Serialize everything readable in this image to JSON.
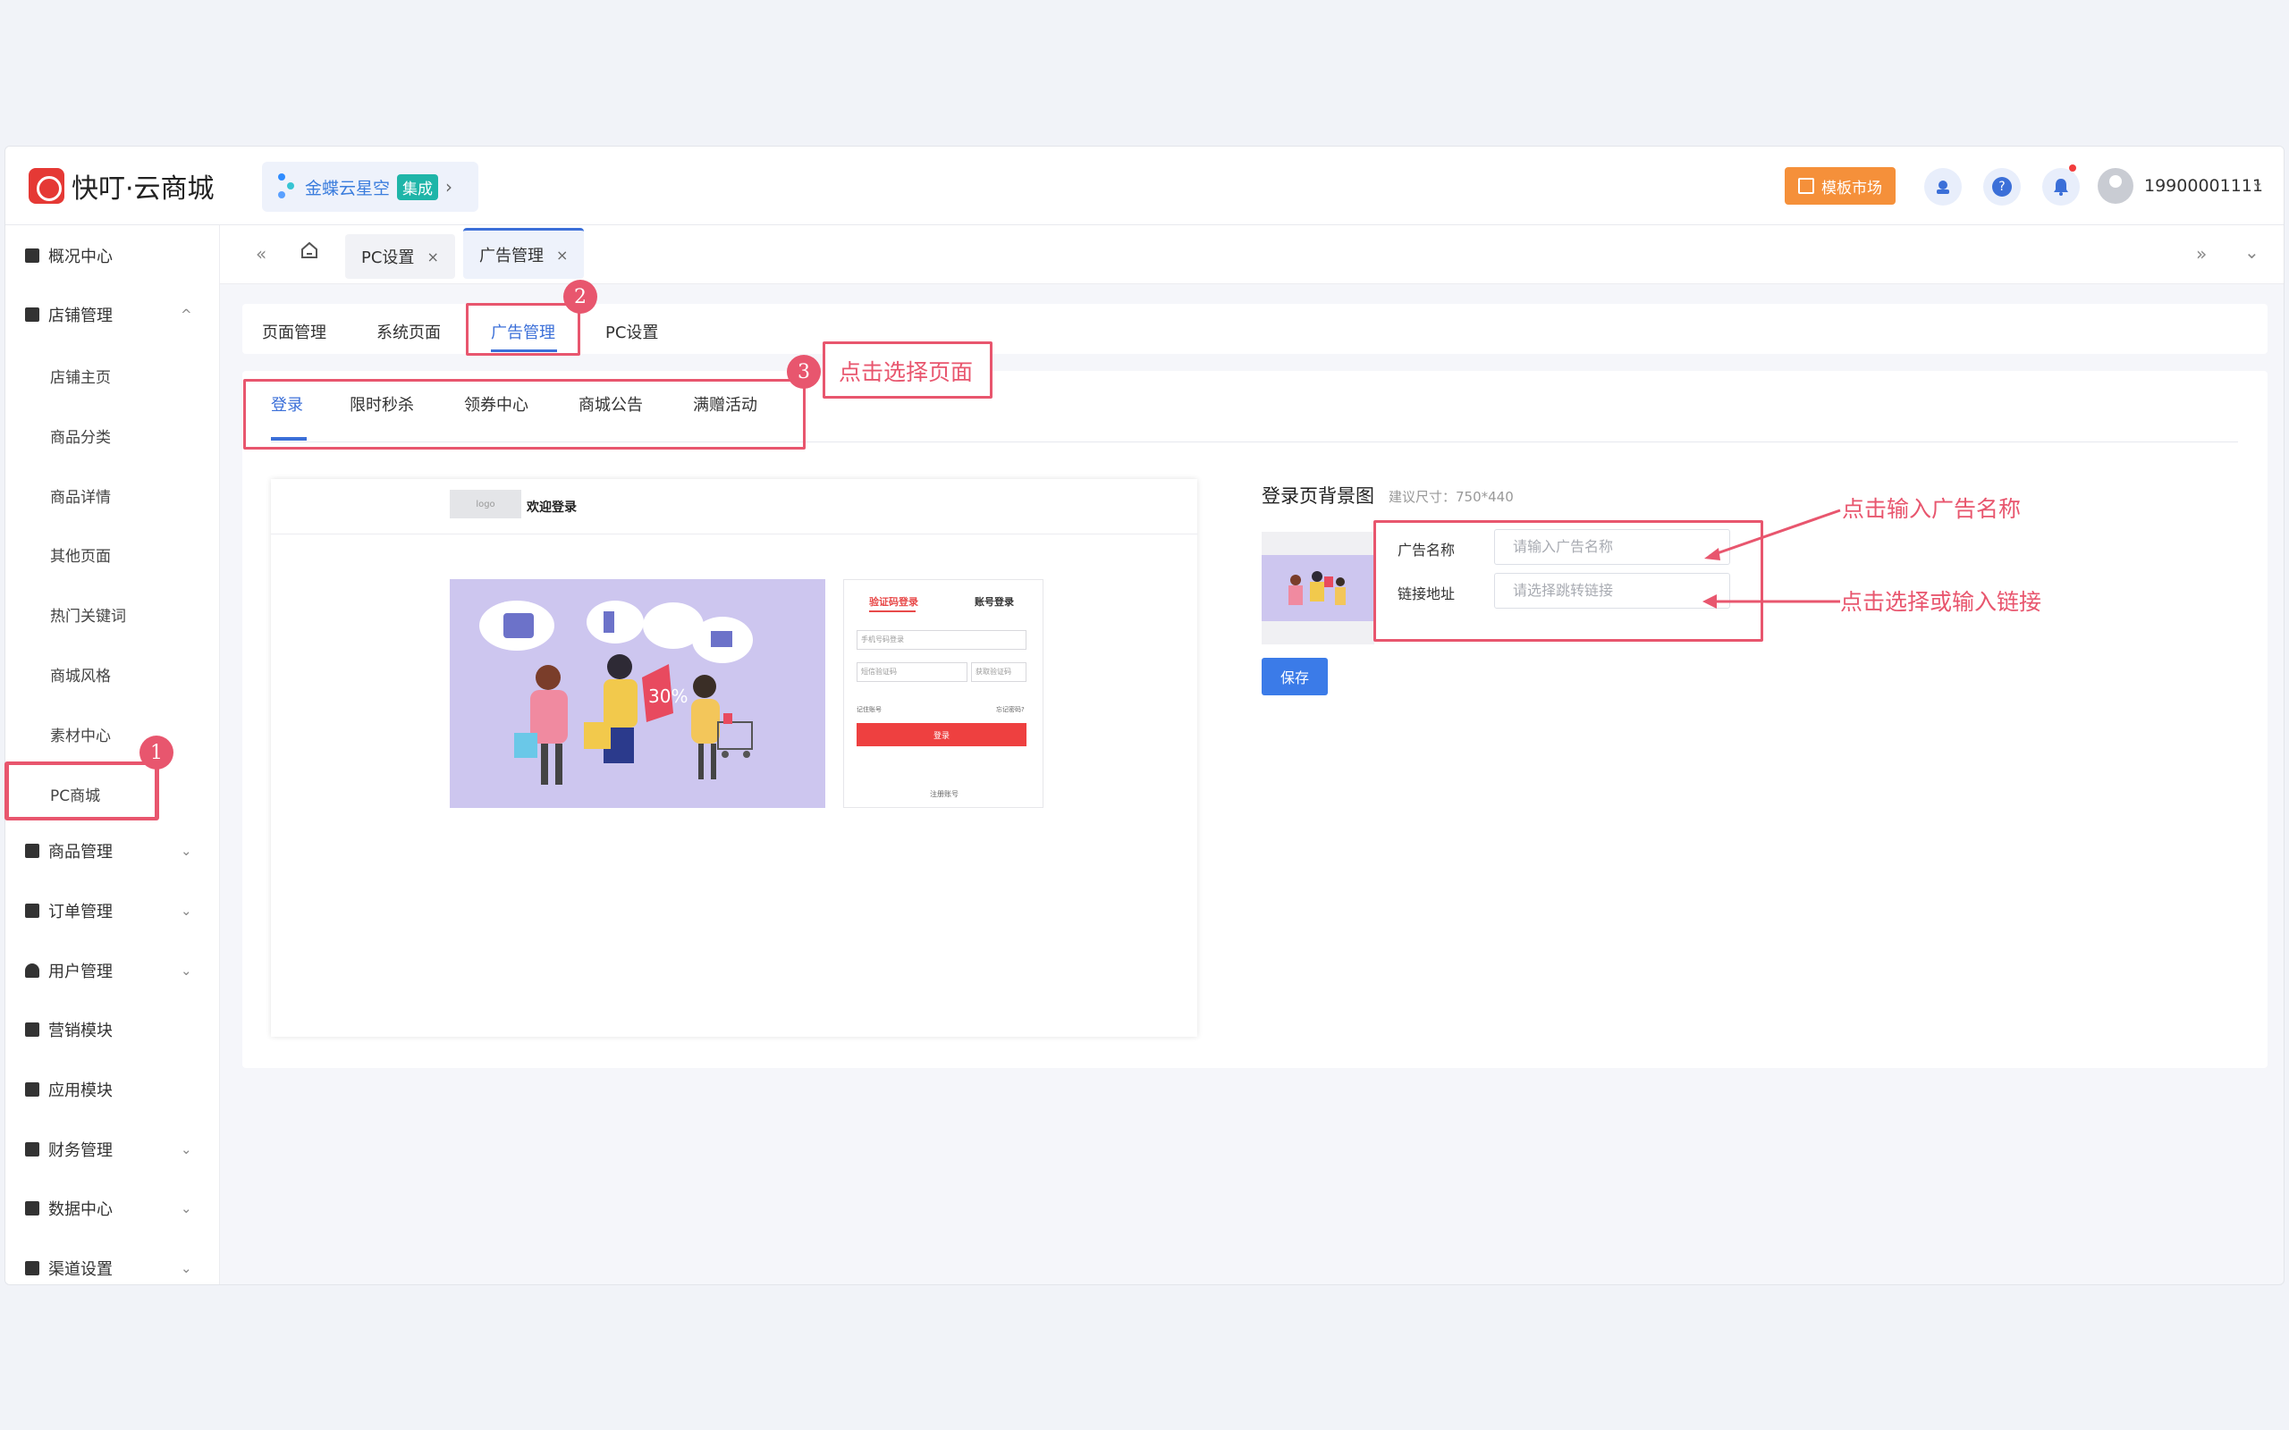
{
  "header": {
    "brand": "快叮·云商城",
    "integration_name": "金蝶云星空",
    "integration_badge": "集成",
    "integration_arrow": "›",
    "template_market": "模板市场",
    "username": "19900001111",
    "user_menu_arrow": "⌄",
    "help_glyph": "?",
    "icons": [
      "service-icon",
      "help-icon",
      "bell-icon",
      "avatar-icon"
    ],
    "accent_color": "#3b6fd8",
    "template_button_color": "#f5903a"
  },
  "sidebar": {
    "items": [
      {
        "label": "概况中心",
        "chevron": ""
      },
      {
        "label": "店铺管理",
        "chevron": "^"
      },
      {
        "label": "店铺主页"
      },
      {
        "label": "商品分类"
      },
      {
        "label": "商品详情"
      },
      {
        "label": "其他页面"
      },
      {
        "label": "热门关键词"
      },
      {
        "label": "商城风格"
      },
      {
        "label": "素材中心"
      },
      {
        "label": "PC商城"
      },
      {
        "label": "商品管理",
        "chevron": "⌄"
      },
      {
        "label": "订单管理",
        "chevron": "⌄"
      },
      {
        "label": "用户管理",
        "chevron": "⌄"
      },
      {
        "label": "营销模块",
        "chevron": ""
      },
      {
        "label": "应用模块",
        "chevron": ""
      },
      {
        "label": "财务管理",
        "chevron": "⌄"
      },
      {
        "label": "数据中心",
        "chevron": "⌄"
      },
      {
        "label": "渠道设置",
        "chevron": "⌄"
      }
    ]
  },
  "tabbar": {
    "collapse_glyph": "«",
    "expand_glyph": "»",
    "menu_glyph": "⌄",
    "tabs": [
      {
        "label": "PC设置",
        "close": "×"
      },
      {
        "label": "广告管理",
        "close": "×"
      }
    ]
  },
  "subnav": {
    "tabs": [
      "页面管理",
      "系统页面",
      "广告管理",
      "PC设置"
    ],
    "active": "广告管理"
  },
  "page_tabs": {
    "tabs": [
      "登录",
      "限时秒杀",
      "领券中心",
      "商城公告",
      "满赠活动"
    ],
    "active": "登录"
  },
  "preview": {
    "logo_placeholder": "logo",
    "welcome": "欢迎登录",
    "banner_sale_text": "30%",
    "login_tab_code": "验证码登录",
    "login_tab_account": "账号登录",
    "phone_placeholder": "手机号码登录",
    "code_placeholder": "短信验证码",
    "get_code": "获取验证码",
    "remember": "记住账号",
    "forgot": "忘记密码?",
    "login_button": "登录",
    "register": "注册账号"
  },
  "settings": {
    "title": "登录页背景图",
    "size_hint": "建议尺寸：750*440",
    "ad_name_label": "广告名称",
    "ad_name_placeholder": "请输入广告名称",
    "link_label": "链接地址",
    "link_placeholder": "请选择跳转链接",
    "save_label": "保存"
  },
  "annotations": {
    "badge1": "1",
    "badge2": "2",
    "badge3": "3",
    "select_page": "点击选择页面",
    "input_ad_name": "点击输入广告名称",
    "select_or_input_link": "点击选择或输入链接",
    "color": "#e8566e"
  }
}
